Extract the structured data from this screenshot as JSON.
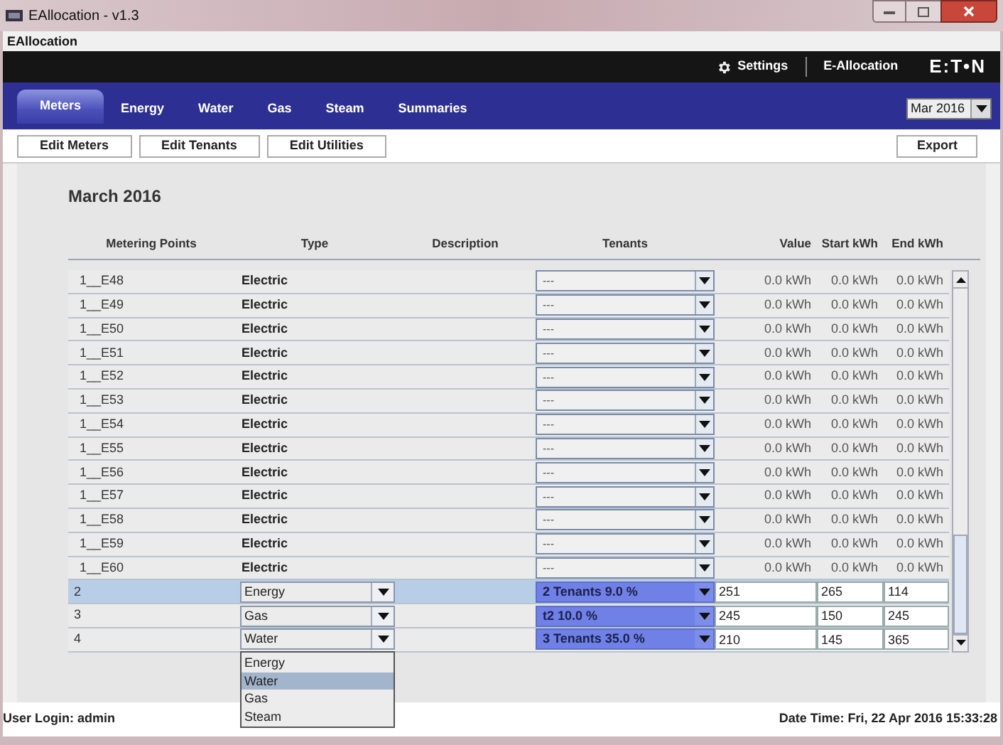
{
  "window": {
    "title": "EAllocation - v1.3"
  },
  "app_label": "EAllocation",
  "header": {
    "settings": "Settings",
    "app_name": "E-Allocation",
    "logo": "E:T•N"
  },
  "tabs": [
    {
      "label": "Meters",
      "selected": true
    },
    {
      "label": "Energy",
      "selected": false
    },
    {
      "label": "Water",
      "selected": false
    },
    {
      "label": "Gas",
      "selected": false
    },
    {
      "label": "Steam",
      "selected": false
    },
    {
      "label": "Summaries",
      "selected": false
    }
  ],
  "month_select": {
    "value": "Mar 2016"
  },
  "toolbar": {
    "buttons": [
      "Edit Meters",
      "Edit Tenants",
      "Edit Utilities"
    ],
    "export": "Export"
  },
  "heading": "March 2016",
  "table": {
    "columns": [
      "Metering Points",
      "Type",
      "Description",
      "Tenants",
      "Value",
      "Start kWh",
      "End kWh"
    ],
    "rows": [
      {
        "kind": "readonly",
        "selected": false,
        "metering_point": "1__E48",
        "type": "Electric",
        "tenants": "---",
        "value": "0.0 kWh",
        "start": "0.0 kWh",
        "end": "0.0 kWh"
      },
      {
        "kind": "readonly",
        "selected": false,
        "metering_point": "1__E49",
        "type": "Electric",
        "tenants": "---",
        "value": "0.0 kWh",
        "start": "0.0 kWh",
        "end": "0.0 kWh"
      },
      {
        "kind": "readonly",
        "selected": false,
        "metering_point": "1__E50",
        "type": "Electric",
        "tenants": "---",
        "value": "0.0 kWh",
        "start": "0.0 kWh",
        "end": "0.0 kWh"
      },
      {
        "kind": "readonly",
        "selected": false,
        "metering_point": "1__E51",
        "type": "Electric",
        "tenants": "---",
        "value": "0.0 kWh",
        "start": "0.0 kWh",
        "end": "0.0 kWh"
      },
      {
        "kind": "readonly",
        "selected": false,
        "metering_point": "1__E52",
        "type": "Electric",
        "tenants": "---",
        "value": "0.0 kWh",
        "start": "0.0 kWh",
        "end": "0.0 kWh"
      },
      {
        "kind": "readonly",
        "selected": false,
        "metering_point": "1__E53",
        "type": "Electric",
        "tenants": "---",
        "value": "0.0 kWh",
        "start": "0.0 kWh",
        "end": "0.0 kWh"
      },
      {
        "kind": "readonly",
        "selected": false,
        "metering_point": "1__E54",
        "type": "Electric",
        "tenants": "---",
        "value": "0.0 kWh",
        "start": "0.0 kWh",
        "end": "0.0 kWh"
      },
      {
        "kind": "readonly",
        "selected": false,
        "metering_point": "1__E55",
        "type": "Electric",
        "tenants": "---",
        "value": "0.0 kWh",
        "start": "0.0 kWh",
        "end": "0.0 kWh"
      },
      {
        "kind": "readonly",
        "selected": false,
        "metering_point": "1__E56",
        "type": "Electric",
        "tenants": "---",
        "value": "0.0 kWh",
        "start": "0.0 kWh",
        "end": "0.0 kWh"
      },
      {
        "kind": "readonly",
        "selected": false,
        "metering_point": "1__E57",
        "type": "Electric",
        "tenants": "---",
        "value": "0.0 kWh",
        "start": "0.0 kWh",
        "end": "0.0 kWh"
      },
      {
        "kind": "readonly",
        "selected": false,
        "metering_point": "1__E58",
        "type": "Electric",
        "tenants": "---",
        "value": "0.0 kWh",
        "start": "0.0 kWh",
        "end": "0.0 kWh"
      },
      {
        "kind": "readonly",
        "selected": false,
        "metering_point": "1__E59",
        "type": "Electric",
        "tenants": "---",
        "value": "0.0 kWh",
        "start": "0.0 kWh",
        "end": "0.0 kWh"
      },
      {
        "kind": "readonly",
        "selected": false,
        "metering_point": "1__E60",
        "type": "Electric",
        "tenants": "---",
        "value": "0.0 kWh",
        "start": "0.0 kWh",
        "end": "0.0 kWh"
      },
      {
        "kind": "editable",
        "selected": true,
        "metering_point": "2",
        "type": "Energy",
        "tenants": "2 Tenants 9.0 %",
        "value": "251",
        "start": "265",
        "end": "114"
      },
      {
        "kind": "editable",
        "selected": false,
        "metering_point": "3",
        "type": "Gas",
        "tenants": "t2 10.0 %",
        "value": "245",
        "start": "150",
        "end": "245"
      },
      {
        "kind": "editable",
        "selected": false,
        "metering_point": "4",
        "type": "Water",
        "tenants": "3 Tenants 35.0 %",
        "value": "210",
        "start": "145",
        "end": "365",
        "dropdown": {
          "options": [
            {
              "label": "Energy",
              "selected": false
            },
            {
              "label": "Water",
              "selected": true
            },
            {
              "label": "Gas",
              "selected": false
            },
            {
              "label": "Steam",
              "selected": false
            }
          ]
        }
      }
    ]
  },
  "status_bar": {
    "user_login": "User Login: admin",
    "date_time": "Date Time: Fri, 22 Apr 2016 15:33:28"
  }
}
